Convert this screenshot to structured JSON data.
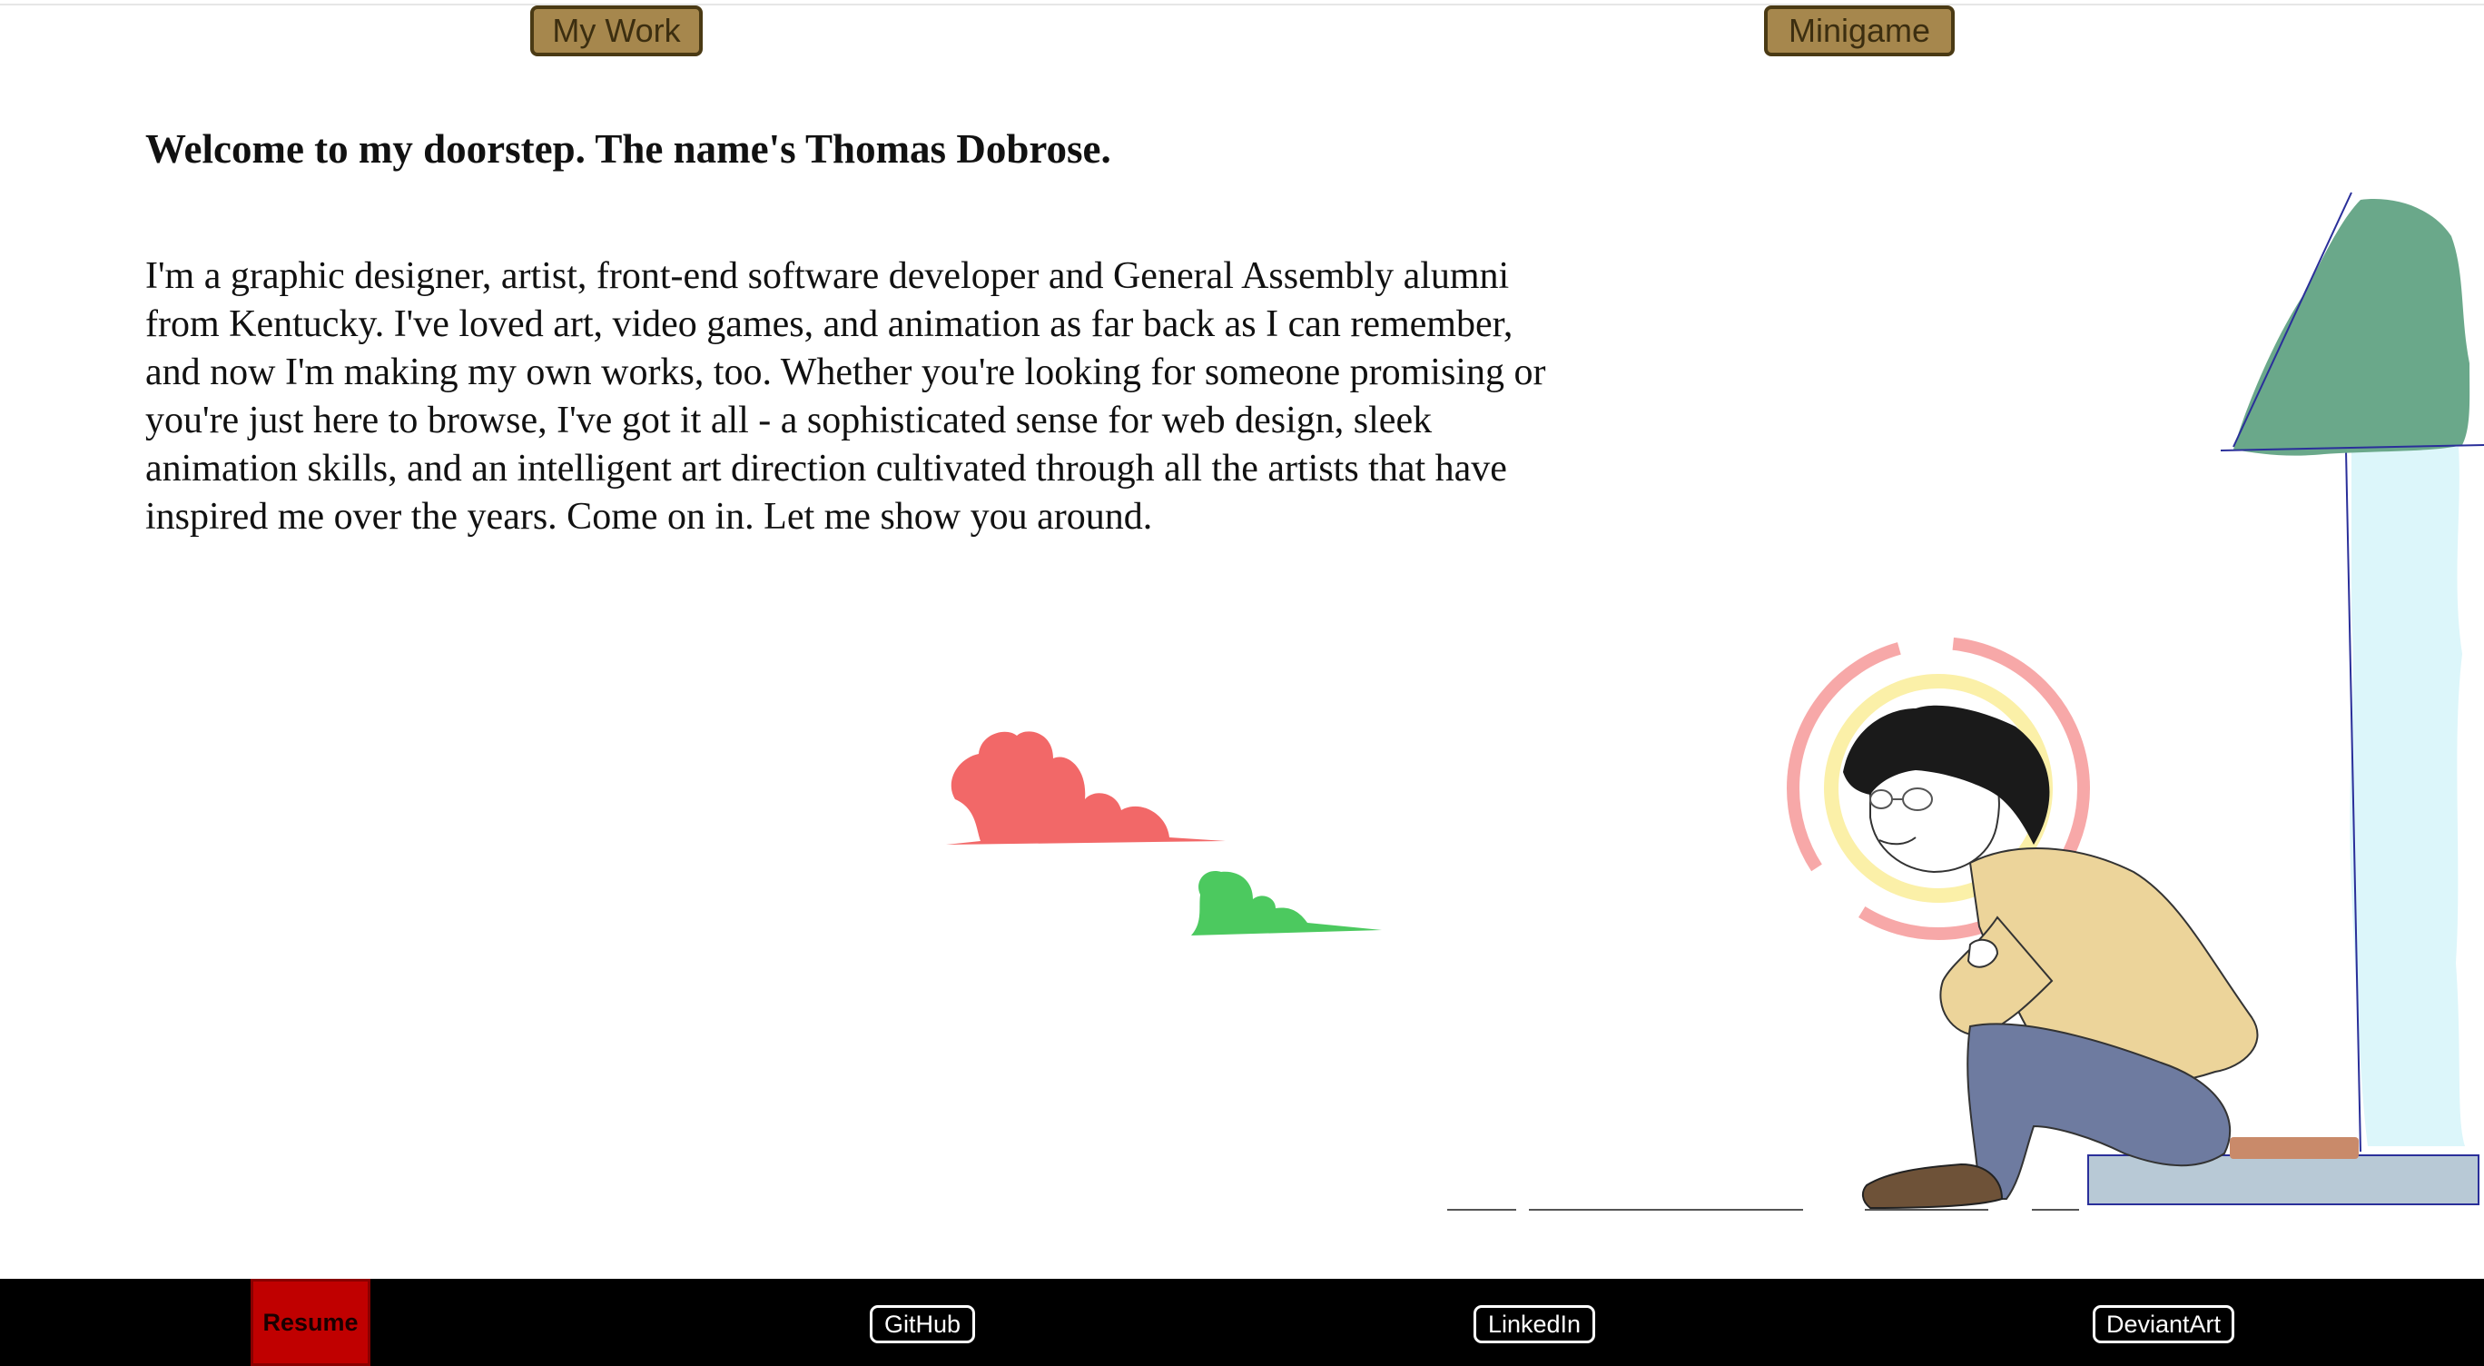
{
  "nav": {
    "my_work": "My Work",
    "minigame": "Minigame"
  },
  "main": {
    "headline": "Welcome to my doorstep. The name's Thomas Dobrose.",
    "intro": "I'm a graphic designer, artist, front-end software developer and General Assembly alumni from Kentucky. I've loved art, video games, and animation as far back as I can remember, and now I'm making my own works, too. Whether you're looking for someone promising or you're just here to browse, I've got it all - a sophisticated sense for web design, sleek animation skills, and an intelligent art direction cultivated through all the artists that have inspired me over the years. Come on in. Let me show you around."
  },
  "footer": {
    "resume": "Resume",
    "github": "GitHub",
    "linkedin": "LinkedIn",
    "deviantart": "DeviantArt"
  },
  "colors": {
    "nav_button": "#a6874d",
    "resume_button": "#c00000",
    "footer_bg": "#000000",
    "cloud_red": "#f26868",
    "cloud_green": "#4cc95f",
    "tree": "#6aa88a",
    "door": "#dcf6fa"
  }
}
